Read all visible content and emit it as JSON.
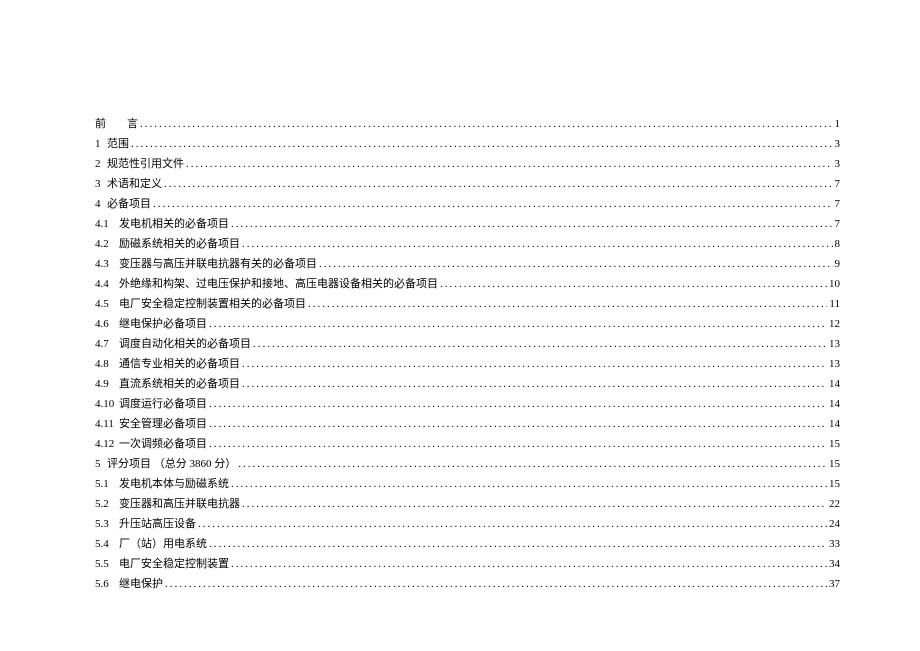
{
  "toc": [
    {
      "num": "前",
      "label": "言",
      "page": "1",
      "cls": "preface"
    },
    {
      "num": "1",
      "label": "范围",
      "page": "3",
      "cls": "top"
    },
    {
      "num": "2",
      "label": "规范性引用文件",
      "page": "3",
      "cls": "top"
    },
    {
      "num": "3",
      "label": "术语和定义",
      "page": "7",
      "cls": "top"
    },
    {
      "num": "4",
      "label": " 必备项目",
      "page": "7",
      "cls": "top"
    },
    {
      "num": "4.1",
      "label": "发电机相关的必备项目",
      "page": "7",
      "cls": "sub"
    },
    {
      "num": "4.2",
      "label": "励磁系统相关的必备项目",
      "page": "8",
      "cls": "sub"
    },
    {
      "num": "4.3",
      "label": "变压器与高压并联电抗器有关的必备项目",
      "page": "9",
      "cls": "sub"
    },
    {
      "num": "4.4",
      "label": "外绝缘和构架、过电压保护和接地、高压电器设备相关的必备项目",
      "page": "10",
      "cls": "sub"
    },
    {
      "num": "4.5",
      "label": "电厂安全稳定控制装置相关的必备项目",
      "page": "11",
      "cls": "sub"
    },
    {
      "num": "4.6",
      "label": "继电保护必备项目",
      "page": "12",
      "cls": "sub"
    },
    {
      "num": "4.7",
      "label": "调度自动化相关的必备项目",
      "page": "13",
      "cls": "sub"
    },
    {
      "num": "4.8",
      "label": "通信专业相关的必备项目",
      "page": "13",
      "cls": "sub"
    },
    {
      "num": "4.9",
      "label": "直流系统相关的必备项目",
      "page": "14",
      "cls": "sub"
    },
    {
      "num": "4.10",
      "label": "调度运行必备项目",
      "page": "14",
      "cls": "sub"
    },
    {
      "num": "4.11",
      "label": "安全管理必备项目",
      "page": "14",
      "cls": "sub"
    },
    {
      "num": "4.12",
      "label": "一次调频必备项目",
      "page": "15",
      "cls": "sub"
    },
    {
      "num": "5",
      "label": " 评分项目 （总分 3860 分）",
      "page": "15",
      "cls": "top"
    },
    {
      "num": "5.1",
      "label": "发电机本体与励磁系统",
      "page": "15",
      "cls": "sub"
    },
    {
      "num": "5.2",
      "label": "变压器和高压并联电抗器",
      "page": "22",
      "cls": "sub"
    },
    {
      "num": "5.3",
      "label": "升压站高压设备",
      "page": "24",
      "cls": "sub"
    },
    {
      "num": "5.4",
      "label": "厂（站）用电系统",
      "page": "33",
      "cls": "sub"
    },
    {
      "num": "5.5",
      "label": " 电厂安全稳定控制装置",
      "page": "34",
      "cls": "sub"
    },
    {
      "num": "5.6",
      "label": "继电保护",
      "page": "37",
      "cls": "sub"
    }
  ]
}
